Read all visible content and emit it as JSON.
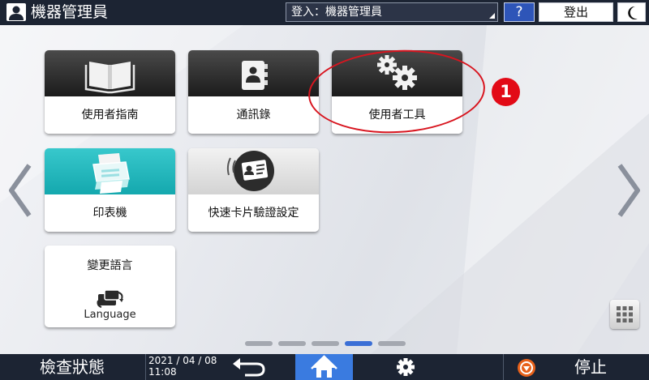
{
  "header": {
    "title": "機器管理員",
    "login_status": "登入：機器管理員",
    "help_label": "?",
    "logout_label": "登出"
  },
  "tiles": [
    {
      "label": "使用者指南",
      "icon": "book-icon"
    },
    {
      "label": "通訊錄",
      "icon": "address-book-icon"
    },
    {
      "label": "使用者工具",
      "icon": "gears-icon"
    },
    {
      "label": "印表機",
      "icon": "printer-icon"
    },
    {
      "label": "快速卡片驗證設定",
      "icon": "id-card-icon"
    }
  ],
  "language_tile": {
    "title": "變更語言",
    "subtitle": "Language",
    "icon": "language-switch-icon"
  },
  "pager": {
    "total": 5,
    "active_index": 3
  },
  "annotation": {
    "number": "1",
    "color": "#e20a16"
  },
  "footer": {
    "check_status_label": "檢查狀態",
    "date": "2021 / 04 / 08",
    "time": "11:08",
    "stop_label": "停止"
  },
  "colors": {
    "accent": "#3a7be0",
    "topbar": "#1c2433",
    "annotation": "#e20a16"
  }
}
